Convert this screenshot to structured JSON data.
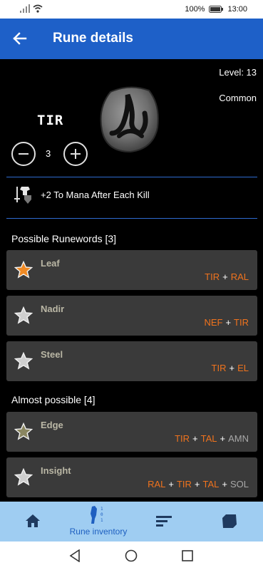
{
  "status": {
    "battery": "100%",
    "time": "13:00"
  },
  "appbar": {
    "title": "Rune details",
    "back_icon": "arrow-left-icon"
  },
  "rune": {
    "name": "TIR",
    "level": "Level: 13",
    "rarity": "Common",
    "count": "3",
    "bonus": "+2 To Mana After Each Kill"
  },
  "possible": {
    "title": "Possible Runewords [3]",
    "items": [
      {
        "name": "Leaf",
        "runes": [
          {
            "t": "TIR",
            "have": true
          },
          {
            "t": "RAL",
            "have": true
          }
        ],
        "star_color": "#f08a24"
      },
      {
        "name": "Nadir",
        "runes": [
          {
            "t": "NEF",
            "have": true
          },
          {
            "t": "TIR",
            "have": true
          }
        ],
        "star_color": "#cfcfcf"
      },
      {
        "name": "Steel",
        "runes": [
          {
            "t": "TIR",
            "have": true
          },
          {
            "t": "EL",
            "have": true
          }
        ],
        "star_color": "#cfcfcf"
      }
    ]
  },
  "almost": {
    "title": "Almost possible [4]",
    "items": [
      {
        "name": "Edge",
        "runes": [
          {
            "t": "TIR",
            "have": true
          },
          {
            "t": "TAL",
            "have": true
          },
          {
            "t": "AMN",
            "have": false
          }
        ],
        "star_color": "#8a8660"
      },
      {
        "name": "Insight",
        "runes": [
          {
            "t": "RAL",
            "have": true
          },
          {
            "t": "TIR",
            "have": true
          },
          {
            "t": "TAL",
            "have": true
          },
          {
            "t": "SOL",
            "have": false
          }
        ],
        "star_color": "#cfcfcf"
      }
    ]
  },
  "nav": {
    "rune_inventory": "Rune inventory"
  },
  "colors": {
    "appbar": "#1e60c8",
    "bottomnav": "#9fcdf2",
    "accent_orange": "#f0731d"
  }
}
